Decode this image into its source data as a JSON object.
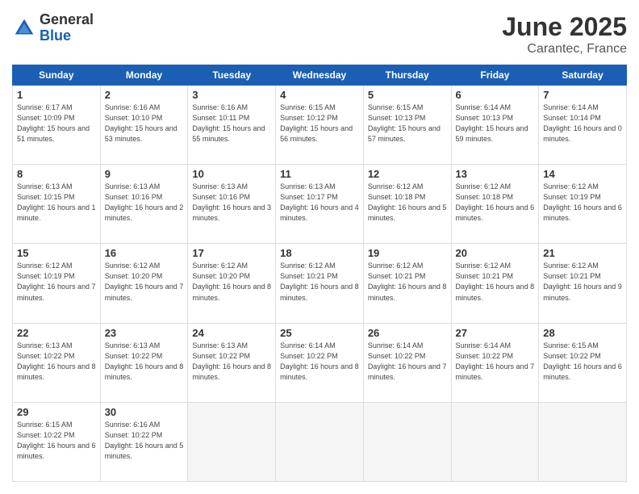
{
  "logo": {
    "general": "General",
    "blue": "Blue"
  },
  "title": {
    "month": "June 2025",
    "location": "Carantec, France"
  },
  "weekdays": [
    "Sunday",
    "Monday",
    "Tuesday",
    "Wednesday",
    "Thursday",
    "Friday",
    "Saturday"
  ],
  "weeks": [
    [
      {
        "day": "1",
        "sunrise": "6:17 AM",
        "sunset": "10:09 PM",
        "daylight": "15 hours and 51 minutes."
      },
      {
        "day": "2",
        "sunrise": "6:16 AM",
        "sunset": "10:10 PM",
        "daylight": "15 hours and 53 minutes."
      },
      {
        "day": "3",
        "sunrise": "6:16 AM",
        "sunset": "10:11 PM",
        "daylight": "15 hours and 55 minutes."
      },
      {
        "day": "4",
        "sunrise": "6:15 AM",
        "sunset": "10:12 PM",
        "daylight": "15 hours and 56 minutes."
      },
      {
        "day": "5",
        "sunrise": "6:15 AM",
        "sunset": "10:13 PM",
        "daylight": "15 hours and 57 minutes."
      },
      {
        "day": "6",
        "sunrise": "6:14 AM",
        "sunset": "10:13 PM",
        "daylight": "15 hours and 59 minutes."
      },
      {
        "day": "7",
        "sunrise": "6:14 AM",
        "sunset": "10:14 PM",
        "daylight": "16 hours and 0 minutes."
      }
    ],
    [
      {
        "day": "8",
        "sunrise": "6:13 AM",
        "sunset": "10:15 PM",
        "daylight": "16 hours and 1 minute."
      },
      {
        "day": "9",
        "sunrise": "6:13 AM",
        "sunset": "10:16 PM",
        "daylight": "16 hours and 2 minutes."
      },
      {
        "day": "10",
        "sunrise": "6:13 AM",
        "sunset": "10:16 PM",
        "daylight": "16 hours and 3 minutes."
      },
      {
        "day": "11",
        "sunrise": "6:13 AM",
        "sunset": "10:17 PM",
        "daylight": "16 hours and 4 minutes."
      },
      {
        "day": "12",
        "sunrise": "6:12 AM",
        "sunset": "10:18 PM",
        "daylight": "16 hours and 5 minutes."
      },
      {
        "day": "13",
        "sunrise": "6:12 AM",
        "sunset": "10:18 PM",
        "daylight": "16 hours and 6 minutes."
      },
      {
        "day": "14",
        "sunrise": "6:12 AM",
        "sunset": "10:19 PM",
        "daylight": "16 hours and 6 minutes."
      }
    ],
    [
      {
        "day": "15",
        "sunrise": "6:12 AM",
        "sunset": "10:19 PM",
        "daylight": "16 hours and 7 minutes."
      },
      {
        "day": "16",
        "sunrise": "6:12 AM",
        "sunset": "10:20 PM",
        "daylight": "16 hours and 7 minutes."
      },
      {
        "day": "17",
        "sunrise": "6:12 AM",
        "sunset": "10:20 PM",
        "daylight": "16 hours and 8 minutes."
      },
      {
        "day": "18",
        "sunrise": "6:12 AM",
        "sunset": "10:21 PM",
        "daylight": "16 hours and 8 minutes."
      },
      {
        "day": "19",
        "sunrise": "6:12 AM",
        "sunset": "10:21 PM",
        "daylight": "16 hours and 8 minutes."
      },
      {
        "day": "20",
        "sunrise": "6:12 AM",
        "sunset": "10:21 PM",
        "daylight": "16 hours and 8 minutes."
      },
      {
        "day": "21",
        "sunrise": "6:12 AM",
        "sunset": "10:21 PM",
        "daylight": "16 hours and 9 minutes."
      }
    ],
    [
      {
        "day": "22",
        "sunrise": "6:13 AM",
        "sunset": "10:22 PM",
        "daylight": "16 hours and 8 minutes."
      },
      {
        "day": "23",
        "sunrise": "6:13 AM",
        "sunset": "10:22 PM",
        "daylight": "16 hours and 8 minutes."
      },
      {
        "day": "24",
        "sunrise": "6:13 AM",
        "sunset": "10:22 PM",
        "daylight": "16 hours and 8 minutes."
      },
      {
        "day": "25",
        "sunrise": "6:14 AM",
        "sunset": "10:22 PM",
        "daylight": "16 hours and 8 minutes."
      },
      {
        "day": "26",
        "sunrise": "6:14 AM",
        "sunset": "10:22 PM",
        "daylight": "16 hours and 7 minutes."
      },
      {
        "day": "27",
        "sunrise": "6:14 AM",
        "sunset": "10:22 PM",
        "daylight": "16 hours and 7 minutes."
      },
      {
        "day": "28",
        "sunrise": "6:15 AM",
        "sunset": "10:22 PM",
        "daylight": "16 hours and 6 minutes."
      }
    ],
    [
      {
        "day": "29",
        "sunrise": "6:15 AM",
        "sunset": "10:22 PM",
        "daylight": "16 hours and 6 minutes."
      },
      {
        "day": "30",
        "sunrise": "6:16 AM",
        "sunset": "10:22 PM",
        "daylight": "16 hours and 5 minutes."
      },
      null,
      null,
      null,
      null,
      null
    ]
  ]
}
